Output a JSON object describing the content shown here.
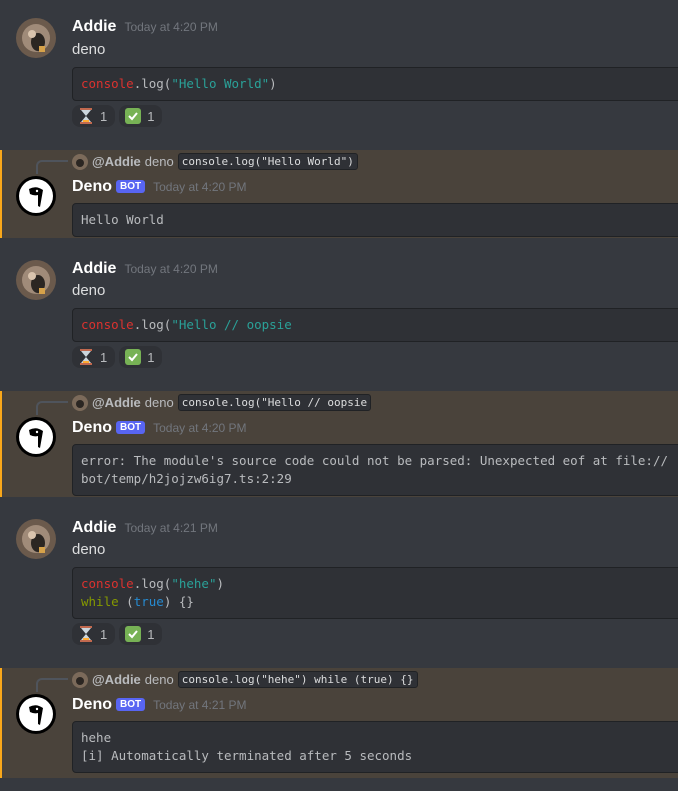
{
  "messages": [
    {
      "user": "Addie",
      "timestamp": "Today at 4:20 PM",
      "text": "deno",
      "code": "console.log(\"Hello World\")",
      "reactions": [
        {
          "emoji": "hourglass",
          "count": "1"
        },
        {
          "emoji": "white-check-mark",
          "count": "1"
        }
      ]
    },
    {
      "reply": {
        "user": "@Addie",
        "text": "deno",
        "code": "console.log(\"Hello World\")"
      },
      "user": "Deno",
      "badge": "BOT",
      "timestamp": "Today at 4:20 PM",
      "code": "Hello World"
    },
    {
      "user": "Addie",
      "timestamp": "Today at 4:20 PM",
      "text": "deno",
      "code": "console.log(\"Hello // oopsie",
      "reactions": [
        {
          "emoji": "hourglass",
          "count": "1"
        },
        {
          "emoji": "white-check-mark",
          "count": "1"
        }
      ]
    },
    {
      "reply": {
        "user": "@Addie",
        "text": "deno",
        "code": "console.log(\"Hello // oopsie"
      },
      "user": "Deno",
      "badge": "BOT",
      "timestamp": "Today at 4:20 PM",
      "code_lines": [
        "error: The module's source code could not be parsed: Unexpected eof at file://",
        "bot/temp/h2jojzw6ig7.ts:2:29"
      ]
    },
    {
      "user": "Addie",
      "timestamp": "Today at 4:21 PM",
      "text": "deno",
      "code_lines": [
        "console.log(\"hehe\")",
        "while (true) {}"
      ],
      "reactions": [
        {
          "emoji": "hourglass",
          "count": "1"
        },
        {
          "emoji": "white-check-mark",
          "count": "1"
        }
      ]
    },
    {
      "reply": {
        "user": "@Addie",
        "text": "deno",
        "code": "console.log(\"hehe\") while (true) {}"
      },
      "user": "Deno",
      "badge": "BOT",
      "timestamp": "Today at 4:21 PM",
      "code_lines": [
        "hehe",
        "[i] Automatically terminated after 5 seconds"
      ]
    }
  ],
  "code_tokens": {
    "console": "console",
    "log_open": ".log(",
    "close": ")",
    "str_hello": "\"Hello World\"",
    "str_oopsie": "\"Hello // oopsie",
    "str_hehe": "\"hehe\"",
    "while": "while",
    "open_paren": " (",
    "true": "true",
    "tail": ") {}"
  }
}
